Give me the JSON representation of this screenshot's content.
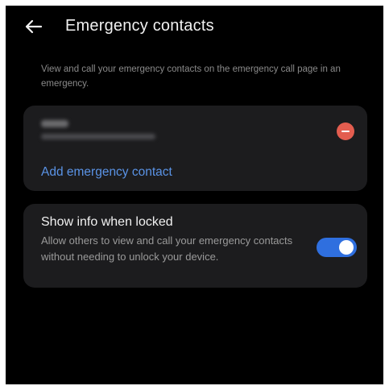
{
  "header": {
    "title": "Emergency contacts",
    "back_icon": "arrow-left-icon"
  },
  "description": "View and call your emergency contacts on the emergency call page in an emergency.",
  "contacts_card": {
    "remove_icon": "minus-circle-icon",
    "add_label": "Add emergency contact"
  },
  "lock_setting": {
    "title": "Show info when locked",
    "subtitle": "Allow others to view and call your emergency contacts without needing to unlock your device.",
    "enabled": true
  },
  "colors": {
    "background": "#000000",
    "card": "#1c1c1e",
    "accent": "#5a93e6",
    "toggle_on": "#2f6fdf",
    "remove": "#e35d4f"
  }
}
